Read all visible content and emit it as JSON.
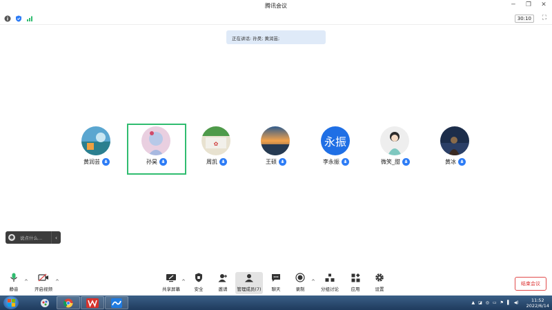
{
  "window": {
    "title": "腾讯会议"
  },
  "timer": "30:10",
  "speaking": {
    "label": "正在讲话:",
    "names": "孙昊; 黄润芸;"
  },
  "participants": [
    {
      "name": "黄润芸",
      "active": false
    },
    {
      "name": "孙昊",
      "active": true
    },
    {
      "name": "周凯",
      "active": false
    },
    {
      "name": "王硕",
      "active": false
    },
    {
      "name": "李永振",
      "active": false,
      "avatar_text": "永振"
    },
    {
      "name": "微笑_甜",
      "active": false
    },
    {
      "name": "黄冰",
      "active": false
    }
  ],
  "chat": {
    "placeholder": "说点什么..."
  },
  "toolbar": {
    "mute": "静音",
    "video": "开启视频",
    "share": "共享屏幕",
    "security": "安全",
    "invite": "邀请",
    "members": "管理成员(7)",
    "chat": "聊天",
    "record": "录制",
    "breakout": "分组讨论",
    "apps": "应用",
    "settings": "设置",
    "end": "结束会议"
  },
  "taskbar": {
    "time": "11:52",
    "date": "2022/6/14"
  },
  "colors": {
    "accent": "#2d7cf6",
    "active_border": "#2fbc6f",
    "end_red": "#e14a4a"
  }
}
